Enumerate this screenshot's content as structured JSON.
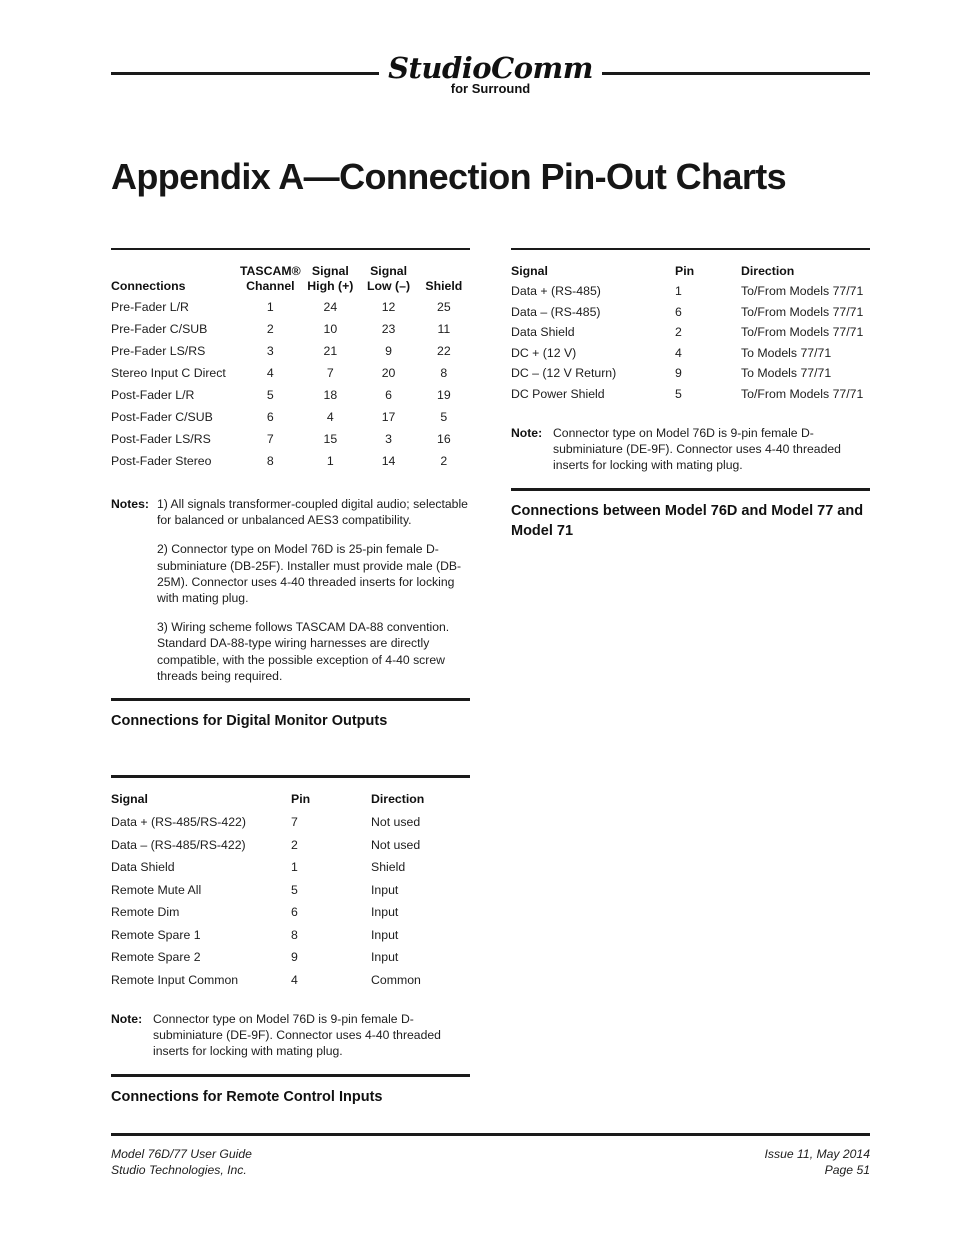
{
  "header": {
    "logo_word": "StudioComm",
    "logo_sub": "for Surround"
  },
  "title": "Appendix A—Connection Pin-Out Charts",
  "left_column": {
    "digital_monitor_table": {
      "headers_top": [
        "",
        "TASCAM®",
        "Signal",
        "Signal",
        ""
      ],
      "headers_bottom": [
        "Connections",
        "Channel",
        "High (+)",
        "Low (–)",
        "Shield"
      ],
      "rows": [
        [
          "Pre-Fader L/R",
          "1",
          "24",
          "12",
          "25"
        ],
        [
          "Pre-Fader C/SUB",
          "2",
          "10",
          "23",
          "11"
        ],
        [
          "Pre-Fader LS/RS",
          "3",
          "21",
          "9",
          "22"
        ],
        [
          "Stereo Input C Direct",
          "4",
          "7",
          "20",
          "8"
        ],
        [
          "Post-Fader L/R",
          "5",
          "18",
          "6",
          "19"
        ],
        [
          "Post-Fader C/SUB",
          "6",
          "4",
          "17",
          "5"
        ],
        [
          "Post-Fader LS/RS",
          "7",
          "15",
          "3",
          "16"
        ],
        [
          "Post-Fader Stereo",
          "8",
          "1",
          "14",
          "2"
        ]
      ]
    },
    "digital_monitor_notes": {
      "label": "Notes:",
      "paragraphs": [
        "1) All signals transformer-coupled digital audio; selectable for balanced or unbalanced AES3 compatibility.",
        "2) Connector type on Model 76D is 25-pin female D-subminiature (DB-25F). Installer must provide male (DB-25M). Connector uses 4-40 threaded inserts for locking with mating plug.",
        "3) Wiring scheme follows TASCAM DA-88 convention. Standard DA-88-type wiring harnesses are directly compatible, with the possible exception of 4-40 screw threads being required."
      ]
    },
    "digital_monitor_caption": "Connections for Digital Monitor Outputs",
    "remote_table": {
      "headers": [
        "Signal",
        "Pin",
        "Direction"
      ],
      "rows": [
        [
          "Data +  (RS-485/RS-422)",
          "7",
          "Not used"
        ],
        [
          "Data –  (RS-485/RS-422)",
          "2",
          "Not used"
        ],
        [
          "Data Shield",
          "1",
          "Shield"
        ],
        [
          "Remote Mute All",
          "5",
          "Input"
        ],
        [
          "Remote Dim",
          "6",
          "Input"
        ],
        [
          "Remote Spare 1",
          "8",
          "Input"
        ],
        [
          "Remote Spare 2",
          "9",
          "Input"
        ],
        [
          "Remote Input Common",
          "4",
          "Common"
        ]
      ]
    },
    "remote_note": {
      "label": "Note:",
      "text": "Connector type on Model 76D is 9-pin female D-subminiature (DE-9F). Connector uses 4-40 threaded inserts for locking with mating plug."
    },
    "remote_caption": "Connections for Remote Control Inputs"
  },
  "right_column": {
    "models_table": {
      "headers": [
        "Signal",
        "Pin",
        "Direction"
      ],
      "rows": [
        [
          "Data +  (RS-485)",
          "1",
          "To/From Models 77/71"
        ],
        [
          "Data –  (RS-485)",
          "6",
          "To/From Models 77/71"
        ],
        [
          "Data Shield",
          "2",
          "To/From Models 77/71"
        ],
        [
          "DC +  (12 V)",
          "4",
          "To Models 77/71"
        ],
        [
          "DC –  (12 V Return)",
          "9",
          "To Models 77/71"
        ],
        [
          "DC Power Shield",
          "5",
          "To/From Models 77/71"
        ]
      ]
    },
    "models_note": {
      "label": "Note:",
      "text": "Connector type on Model 76D is 9-pin female D-subminiature (DE-9F). Connector uses 4-40 threaded inserts for locking with mating plug."
    },
    "models_caption": "Connections between Model 76D and Model 77 and Model 71"
  },
  "footer": {
    "left_line1": "Model 76D/77 User Guide",
    "left_line2": "Studio Technologies, Inc.",
    "right_line1": "Issue 11, May 2014",
    "right_line2": "Page 51"
  }
}
